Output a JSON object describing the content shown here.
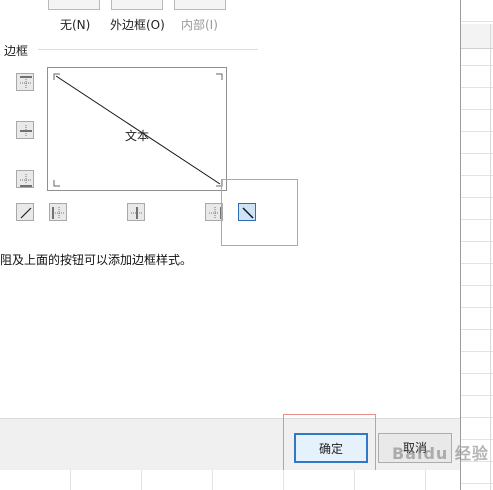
{
  "presets": {
    "none_label": "无(N)",
    "outline_label": "外边框(O)",
    "inside_label": "内部(I)"
  },
  "border_group": {
    "title": "边框",
    "preview_text": "文本"
  },
  "hint_text": "阻及上面的按钮可以添加边框样式。",
  "buttons": {
    "ok_label": "确定",
    "cancel_label": "取消"
  },
  "watermark_text": "Baidu 经验",
  "icons": {
    "top_border": "border-top-icon",
    "middle_horizontal": "border-inside-horizontal-icon",
    "bottom_border": "border-bottom-icon",
    "diagonal_up": "border-diagonal-up-icon",
    "left_border": "border-left-icon",
    "middle_vertical": "border-inside-vertical-icon",
    "right_border": "border-right-icon",
    "diagonal_down": "border-diagonal-down-icon"
  },
  "colors": {
    "highlight": "#e8908a",
    "selected": "#2f6db5"
  }
}
